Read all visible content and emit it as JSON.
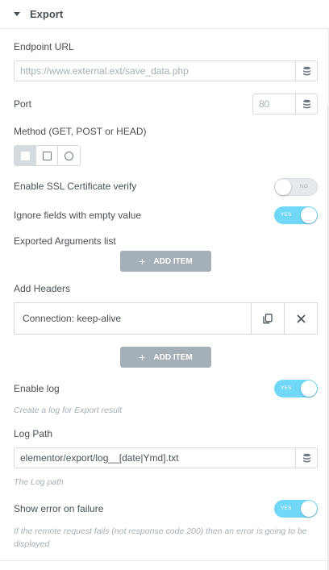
{
  "section": {
    "title": "Export",
    "expanded": true
  },
  "endpoint": {
    "label": "Endpoint URL",
    "placeholder": "https://www.external.ext/save_data.php",
    "value": ""
  },
  "port": {
    "label": "Port",
    "placeholder": "80",
    "value": ""
  },
  "method": {
    "label": "Method (GET, POST or HEAD)",
    "options": [
      "GET",
      "POST",
      "HEAD"
    ],
    "selected": "GET"
  },
  "ssl": {
    "label": "Enable SSL Certificate verify",
    "state": "NO"
  },
  "ignore_empty": {
    "label": "Ignore fields with empty value",
    "state": "YES"
  },
  "exported_args": {
    "label": "Exported Arguments list",
    "add_label": "ADD ITEM"
  },
  "headers": {
    "label": "Add Headers",
    "items": [
      "Connection: keep-alive"
    ],
    "add_label": "ADD ITEM"
  },
  "enable_log": {
    "label": "Enable log",
    "state": "YES",
    "description": "Create a log for Export result"
  },
  "log_path": {
    "label": "Log Path",
    "value": "elementor/export/log__[date|Ymd].txt",
    "description": "The Log path"
  },
  "show_error": {
    "label": "Show error on failure",
    "state": "YES",
    "description": "If the remote request fails (not response code 200) then an error is going to be displayed"
  },
  "colors": {
    "switch_on": "#71d7f7",
    "button": "#a4afb7",
    "text": "#495157",
    "muted": "#a4afb7",
    "border": "#d5dadf"
  },
  "icons": {
    "dynamic": "database-icon",
    "duplicate": "copy-icon",
    "remove": "close-icon",
    "caret": "caret-down-icon",
    "add": "plus-icon"
  }
}
